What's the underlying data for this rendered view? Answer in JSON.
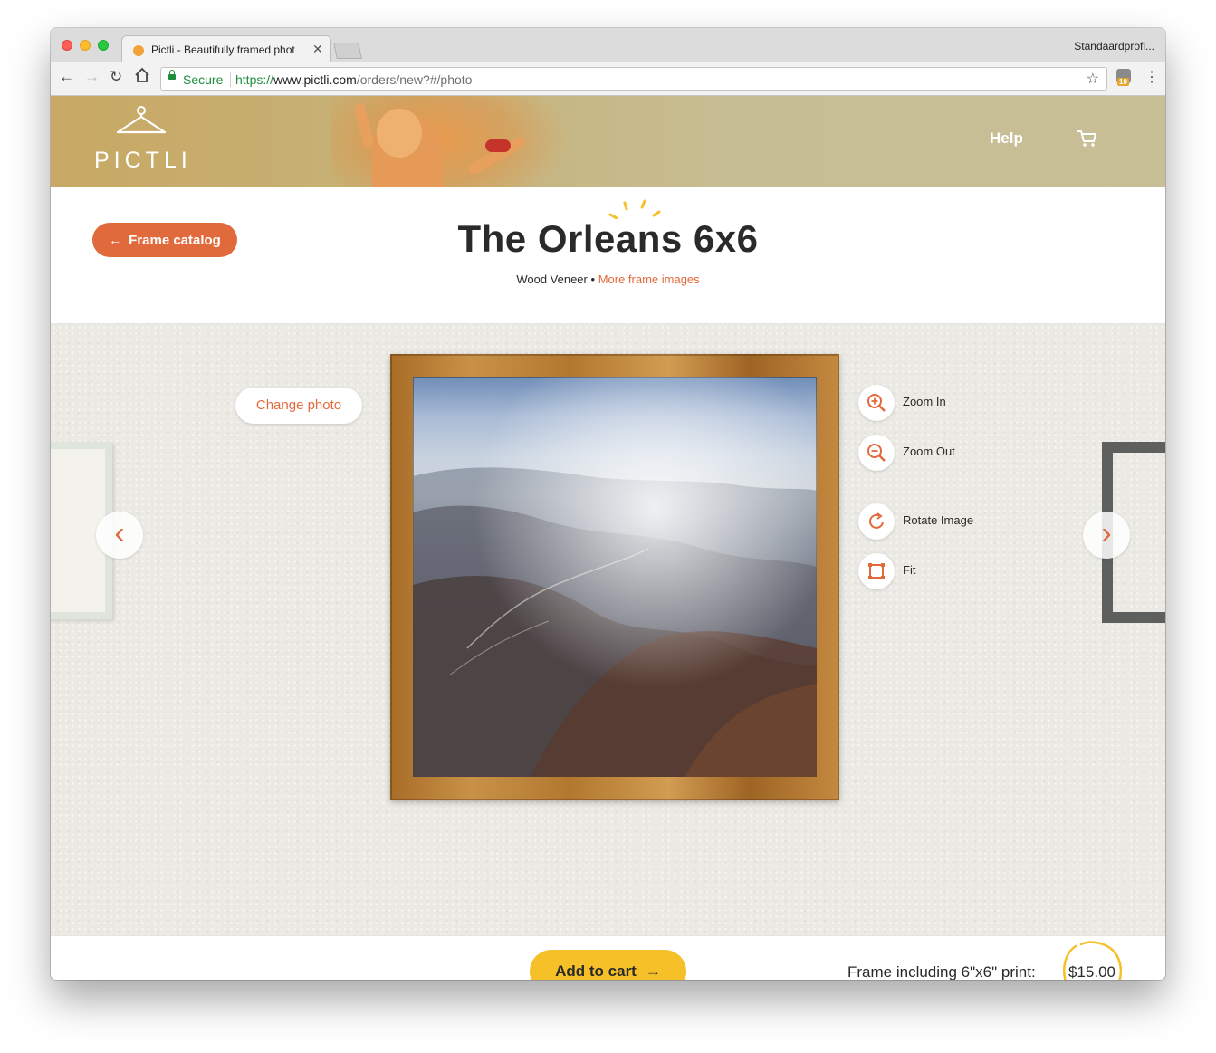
{
  "browser": {
    "tab_title": "Pictli - Beautifully framed phot",
    "profile": "Standaardprofi...",
    "secure_label": "Secure",
    "url_scheme": "https://",
    "url_host": "www.pictli.com",
    "url_path": "/orders/new?#/photo",
    "extension_badge": "10",
    "icons": {
      "back": "back-arrow-icon",
      "forward": "forward-arrow-icon",
      "reload": "reload-icon",
      "home": "home-icon",
      "star": "bookmark-star-icon",
      "menu": "kebab-menu-icon"
    }
  },
  "header": {
    "logo_text": "PICTLI",
    "help_label": "Help",
    "cart_icon": "cart-icon",
    "background_color": "#c7b88a"
  },
  "title_band": {
    "back_button_label": "Frame catalog",
    "title": "The Orleans 6x6",
    "material": "Wood Veneer",
    "separator": "•",
    "more_images_link": "More frame images"
  },
  "canvas": {
    "change_photo_label": "Change photo",
    "tools": [
      {
        "label": "Zoom In",
        "icon": "zoom-in-icon"
      },
      {
        "label": "Zoom Out",
        "icon": "zoom-out-icon"
      },
      {
        "label": "Rotate Image",
        "icon": "rotate-icon"
      },
      {
        "label": "Fit",
        "icon": "fit-icon"
      }
    ]
  },
  "footer": {
    "add_to_cart_label": "Add to cart",
    "price_label": "Frame including 6\"x6\" print:",
    "price": "$15.00"
  },
  "colors": {
    "accent": "#e16a3d",
    "cta": "#f6c029",
    "text": "#2a2a2a"
  }
}
